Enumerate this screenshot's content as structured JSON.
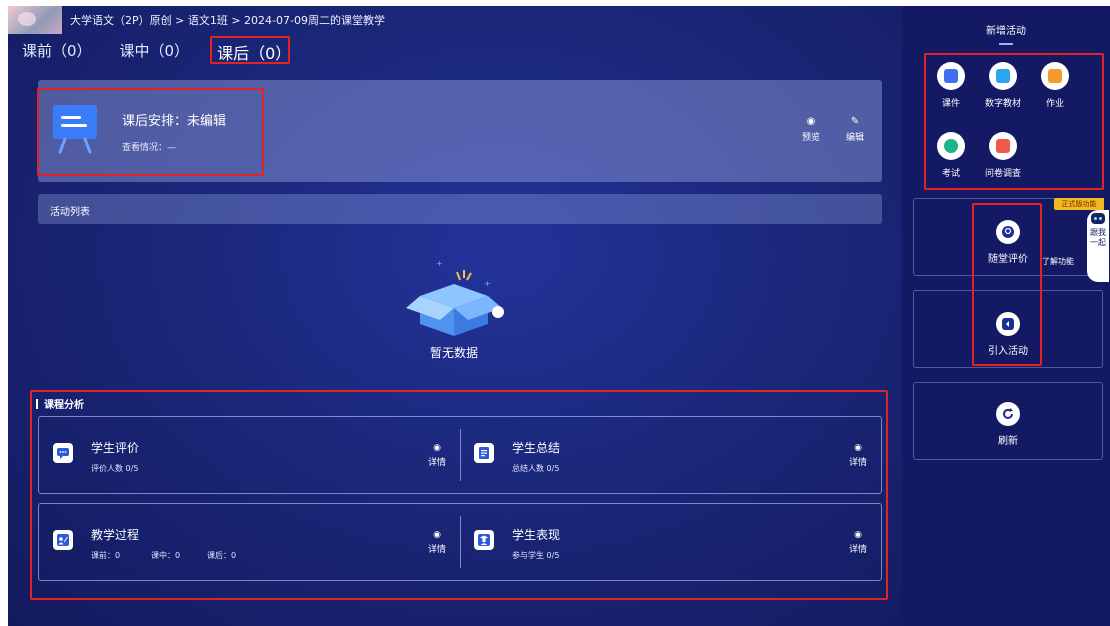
{
  "header": {
    "breadcrumb": "大学语文（2P）原创 > 语文1班 > 2024-07-09周二的课堂教学"
  },
  "tabs": [
    {
      "label": "课前（0）"
    },
    {
      "label": "课中（0）"
    },
    {
      "label": "课后（0）"
    }
  ],
  "arrangement": {
    "title": "课后安排：未编辑",
    "status": "查看情况：—",
    "preview_label": "预览",
    "edit_label": "编辑"
  },
  "activity_list_label": "活动列表",
  "empty_text": "暂无数据",
  "analysis": {
    "title": "课程分析",
    "detail_label": "详情",
    "student_eval": {
      "title": "学生评价",
      "sub": "评价人数 0/5"
    },
    "student_summary": {
      "title": "学生总结",
      "sub": "总结人数 0/5"
    },
    "teaching_process": {
      "title": "教学过程",
      "before": "课前：0",
      "during": "课中：0",
      "after": "课后：0"
    },
    "student_performance": {
      "title": "学生表现",
      "sub": "参与学生 0/5"
    }
  },
  "right_panel": {
    "title": "新增活动",
    "tools": [
      {
        "label": "课件",
        "icon": "courseware-icon",
        "color": "#3f6ef0"
      },
      {
        "label": "数字教材",
        "icon": "digital-textbook-icon",
        "color": "#29a8f0"
      },
      {
        "label": "作业",
        "icon": "homework-icon",
        "color": "#f59a2e"
      },
      {
        "label": "考试",
        "icon": "exam-icon",
        "color": "#1db38a"
      },
      {
        "label": "问卷调查",
        "icon": "survey-icon",
        "color": "#ef5a4a"
      }
    ],
    "class_eval_label": "随堂评价",
    "learn_more_label": "了解功能",
    "import_label": "引入活动",
    "refresh_label": "刷新",
    "promo_label": "正式版功能",
    "robot_label": "跟我一起"
  },
  "colors": {
    "highlight_red": "#e02424",
    "panel_bg": "#131a63",
    "icon_blue": "#2b5bd8"
  }
}
